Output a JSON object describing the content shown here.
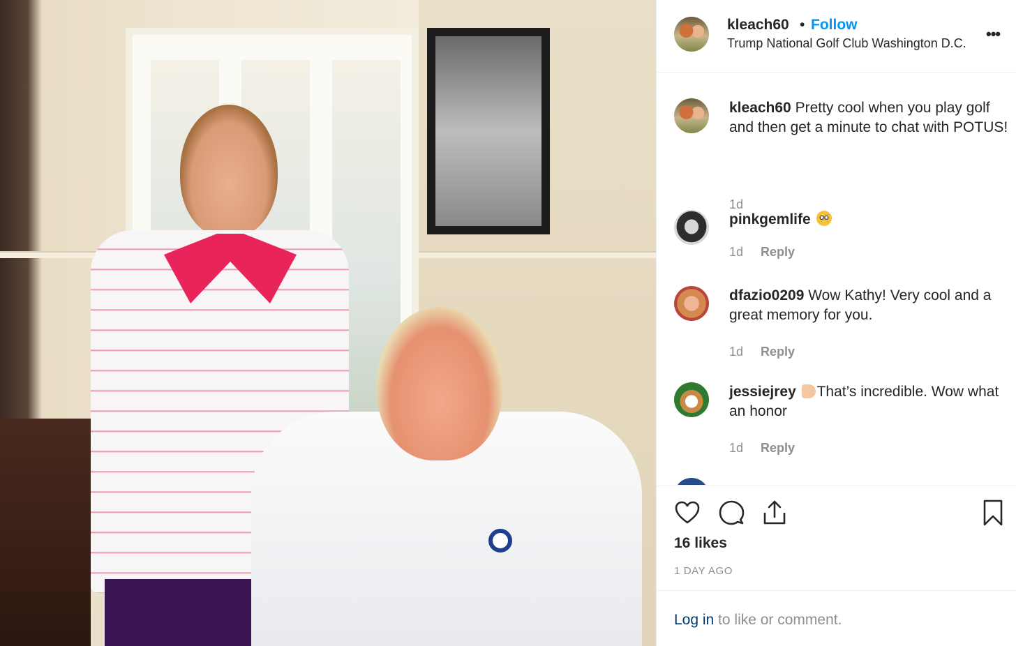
{
  "header": {
    "username": "kleach60",
    "separator": "•",
    "follow_label": "Follow",
    "location": "Trump National Golf Club Washington D.C.",
    "more_label": "•••"
  },
  "comments": [
    {
      "username": "kleach60",
      "text": " Pretty cool when you play golf and then get a minute to chat with POTUS!",
      "time": "1d",
      "reply": ""
    },
    {
      "username": "pinkgemlife",
      "text": " ",
      "emoji": "flushed-face-emoji",
      "time": "1d",
      "reply": "Reply"
    },
    {
      "username": "dfazio0209",
      "text": " Wow Kathy! Very cool and a great memory for you.",
      "time": "1d",
      "reply": "Reply"
    },
    {
      "username": "jessiejrey",
      "text": "That’s incredible. Wow what an honor",
      "emoji": "thumbs-up-emoji",
      "time": "1d",
      "reply": "Reply"
    }
  ],
  "actions": {
    "icons": [
      "heart-icon",
      "comment-icon",
      "share-icon",
      "bookmark-icon"
    ],
    "likes": "16 likes",
    "date": "1 DAY AGO"
  },
  "footer": {
    "login_link": "Log in",
    "login_rest": " to like or comment."
  },
  "colors": {
    "follow": "#0095f6",
    "text": "#262626",
    "muted": "#8e8e8e",
    "link": "#00376b",
    "divider": "#efefef"
  }
}
